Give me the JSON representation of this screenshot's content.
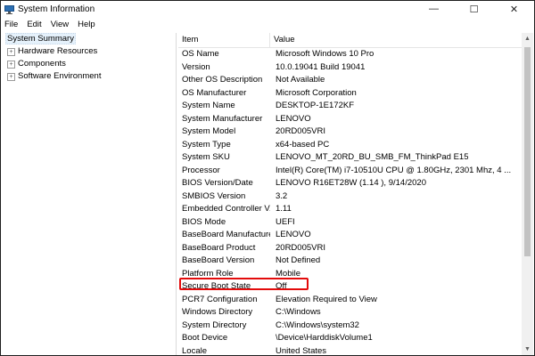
{
  "window": {
    "title": "System Information",
    "icon": "monitor-icon",
    "controls": {
      "minimize": "—",
      "maximize": "☐",
      "close": "✕"
    }
  },
  "menu": [
    "File",
    "Edit",
    "View",
    "Help"
  ],
  "tree": {
    "root": "System Summary",
    "children": [
      {
        "label": "Hardware Resources",
        "expander": "+"
      },
      {
        "label": "Components",
        "expander": "+"
      },
      {
        "label": "Software Environment",
        "expander": "+"
      }
    ]
  },
  "table": {
    "headers": {
      "item": "Item",
      "value": "Value"
    },
    "rows": [
      {
        "item": "OS Name",
        "value": "Microsoft Windows 10 Pro"
      },
      {
        "item": "Version",
        "value": "10.0.19041 Build 19041"
      },
      {
        "item": "Other OS Description",
        "value": "Not Available"
      },
      {
        "item": "OS Manufacturer",
        "value": "Microsoft Corporation"
      },
      {
        "item": "System Name",
        "value": "DESKTOP-1E172KF"
      },
      {
        "item": "System Manufacturer",
        "value": "LENOVO"
      },
      {
        "item": "System Model",
        "value": "20RD005VRI"
      },
      {
        "item": "System Type",
        "value": "x64-based PC"
      },
      {
        "item": "System SKU",
        "value": "LENOVO_MT_20RD_BU_SMB_FM_ThinkPad E15"
      },
      {
        "item": "Processor",
        "value": "Intel(R) Core(TM) i7-10510U CPU @ 1.80GHz, 2301 Mhz, 4 ..."
      },
      {
        "item": "BIOS Version/Date",
        "value": "LENOVO R16ET28W (1.14 ), 9/14/2020"
      },
      {
        "item": "SMBIOS Version",
        "value": "3.2"
      },
      {
        "item": "Embedded Controller V...",
        "value": "1.11"
      },
      {
        "item": "BIOS Mode",
        "value": "UEFI"
      },
      {
        "item": "BaseBoard Manufacturer",
        "value": "LENOVO"
      },
      {
        "item": "BaseBoard Product",
        "value": "20RD005VRI"
      },
      {
        "item": "BaseBoard Version",
        "value": "Not Defined"
      },
      {
        "item": "Platform Role",
        "value": "Mobile"
      },
      {
        "item": "Secure Boot State",
        "value": "Off"
      },
      {
        "item": "PCR7 Configuration",
        "value": "Elevation Required to View"
      },
      {
        "item": "Windows Directory",
        "value": "C:\\Windows"
      },
      {
        "item": "System Directory",
        "value": "C:\\Windows\\system32"
      },
      {
        "item": "Boot Device",
        "value": "\\Device\\HarddiskVolume1"
      },
      {
        "item": "Locale",
        "value": "United States"
      }
    ],
    "highlighted_item": "Secure Boot State"
  },
  "colors": {
    "highlight_border": "#e30b0b",
    "selection": "#e5f1fb"
  }
}
